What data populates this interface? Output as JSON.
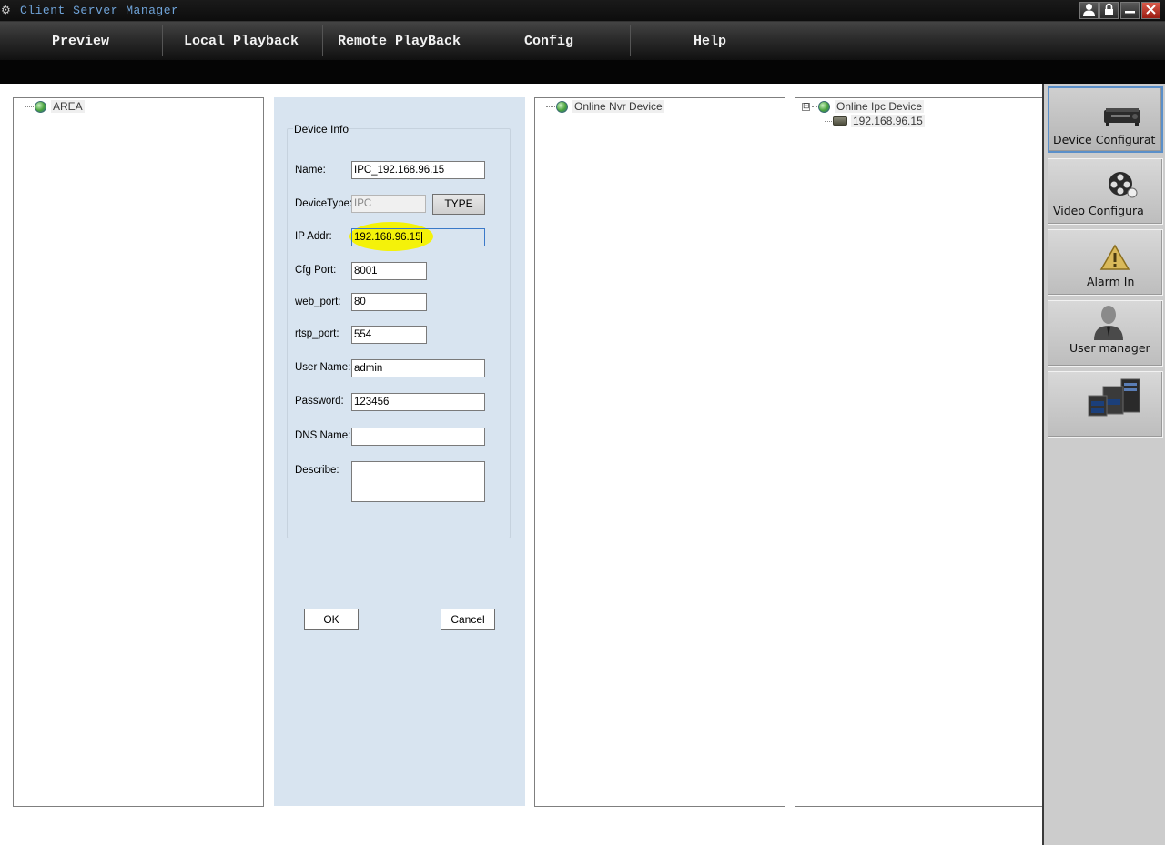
{
  "window": {
    "title": "Client Server Manager",
    "app_icon": "gear-icon",
    "buttons": [
      "user-icon",
      "lock-icon",
      "minimize-icon",
      "close-icon"
    ]
  },
  "menu": {
    "items": [
      "Preview",
      "Local Playback",
      "Remote PlayBack",
      "Config",
      "Help"
    ]
  },
  "area_tree": {
    "root": "AREA",
    "icon": "globe-icon"
  },
  "device_info": {
    "group_title": "Device Info",
    "name_label": "Name:",
    "name_value": "IPC_192.168.96.15",
    "type_label": "DeviceType:",
    "type_value": "IPC",
    "type_button": "TYPE",
    "ip_label": "IP Addr:",
    "ip_value": "192.168.96.15",
    "cfg_port_label": "Cfg Port:",
    "cfg_port_value": "8001",
    "web_port_label": "web_port:",
    "web_port_value": "80",
    "rtsp_port_label": "rtsp_port:",
    "rtsp_port_value": "554",
    "user_label": "User Name:",
    "user_value": "admin",
    "password_label": "Password:",
    "password_value": "123456",
    "dns_label": "DNS Name:",
    "dns_value": "",
    "describe_label": "Describe:",
    "describe_value": "",
    "ok": "OK",
    "cancel": "Cancel"
  },
  "nvr_tree": {
    "root": "Online Nvr Device"
  },
  "ipc_tree": {
    "root": "Online Ipc Device",
    "expander": "⊟",
    "children": [
      "192.168.96.15"
    ]
  },
  "sidebar": {
    "items": [
      {
        "label": "Device Configurat",
        "icon": "projector-icon",
        "active": true
      },
      {
        "label": "Video Configura",
        "icon": "film-reel-icon",
        "active": false
      },
      {
        "label": "Alarm In",
        "icon": "warning-icon",
        "active": false
      },
      {
        "label": "User manager",
        "icon": "user-icon",
        "active": false
      },
      {
        "label": "",
        "icon": "server-icon",
        "active": false
      }
    ]
  },
  "colors": {
    "form_bg": "#d8e4f0",
    "menu_bg": "#2b2b2b",
    "title_text": "#6fa3d8",
    "highlight": "#f4f20a",
    "sidebar_bg": "#cccccc"
  }
}
